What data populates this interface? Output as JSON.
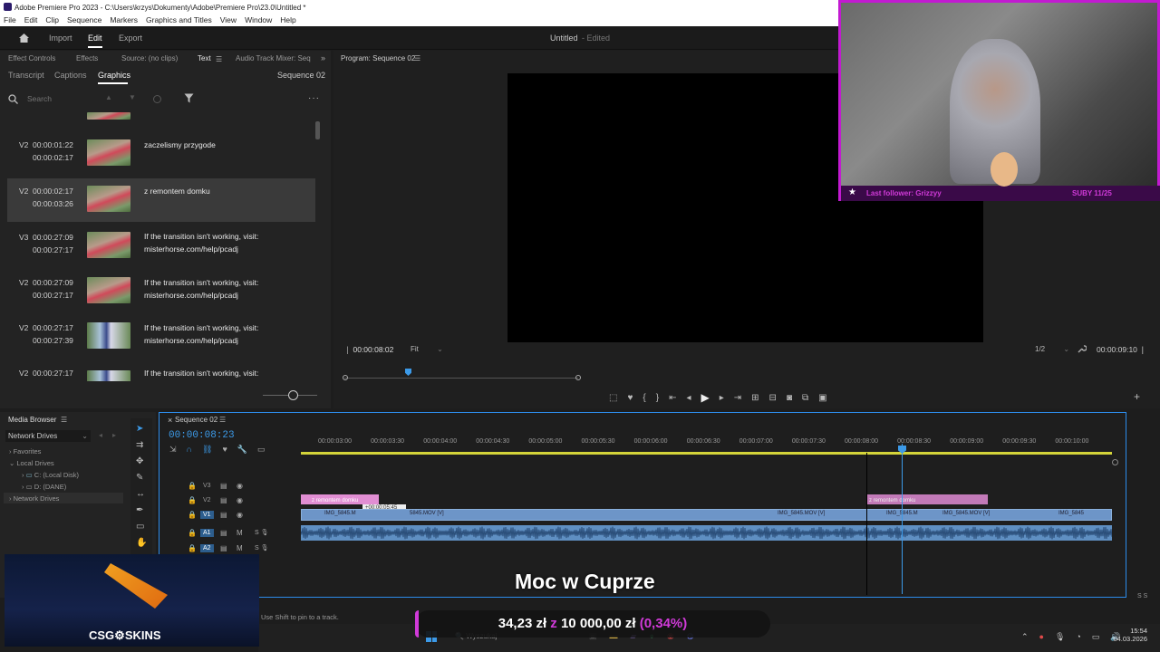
{
  "window": {
    "title": "Adobe Premiere Pro 2023 - C:\\Users\\krzys\\Dokumenty\\Adobe\\Premiere Pro\\23.0\\Untitled *"
  },
  "menu": [
    "File",
    "Edit",
    "Clip",
    "Sequence",
    "Markers",
    "Graphics and Titles",
    "View",
    "Window",
    "Help"
  ],
  "appbar": {
    "import": "Import",
    "edit": "Edit",
    "export": "Export",
    "project": "Untitled",
    "status": "- Edited"
  },
  "source_panel": {
    "tabs": [
      "Effect Controls",
      "Effects",
      "Source: (no clips)",
      "Text",
      "Audio Track Mixer: Seq"
    ],
    "subtabs": [
      "Transcript",
      "Captions",
      "Graphics"
    ],
    "sequence": "Sequence 02",
    "search_placeholder": "Search",
    "items": [
      {
        "track": "V2",
        "in": "00:00:01:22",
        "out": "00:00:02:17",
        "text1": "zaczelismy przygode",
        "text2": ""
      },
      {
        "track": "V2",
        "in": "00:00:02:17",
        "out": "00:00:03:26",
        "text1": "z remontem domku",
        "text2": ""
      },
      {
        "track": "V3",
        "in": "00:00:27:09",
        "out": "00:00:27:17",
        "text1": "If the transition isn't working, visit:",
        "text2": "misterhorse.com/help/pcadj"
      },
      {
        "track": "V2",
        "in": "00:00:27:09",
        "out": "00:00:27:17",
        "text1": "If the transition isn't working, visit:",
        "text2": "misterhorse.com/help/pcadj"
      },
      {
        "track": "V2",
        "in": "00:00:27:17",
        "out": "00:00:27:39",
        "text1": "If the transition isn't working, visit:",
        "text2": "misterhorse.com/help/pcadj"
      },
      {
        "track": "V2",
        "in": "00:00:27:17",
        "out": "",
        "text1": "If the transition isn't working, visit:",
        "text2": ""
      }
    ]
  },
  "program": {
    "title": "Program: Sequence 02",
    "timecode": "00:00:08:02",
    "fit": "Fit",
    "ratio": "1/2",
    "duration": "00:00:09:10"
  },
  "media_browser": {
    "title": "Media Browser",
    "location": "Network Drives",
    "tree": [
      "Favorites",
      "Local Drives",
      "C: (Local Disk)",
      "D: (DANE)",
      "Network Drives"
    ]
  },
  "timeline": {
    "title": "Sequence 02",
    "timecode": "00:00:08:23",
    "ruler": [
      "00:00:03:00",
      "00:00:03:30",
      "00:00:04:00",
      "00:00:04:30",
      "00:00:05:00",
      "00:00:05:30",
      "00:00:06:00",
      "00:00:06:30",
      "00:00:07:00",
      "00:00:07:30",
      "00:00:08:00",
      "00:00:08:30",
      "00:00:09:00",
      "00:00:09:30",
      "00:00:10:00"
    ],
    "tracks": [
      "V3",
      "V2",
      "V1",
      "A1",
      "A2"
    ],
    "clip_labels": {
      "g1": "z remontem domku",
      "g2": "z remontem domku",
      "tooltip": "+00:00:05:45",
      "v_a": "IMG_5845.M",
      "v_b": "5845.MOV [V]",
      "v_c": "IMG_5845.MOV [V]",
      "v_d": "IMG_5845.M",
      "v_e": "IMG_5845.MOV [V]",
      "v_f": "IMG_5845"
    }
  },
  "status_hint": "Use Shift to pin to a track.",
  "overlays": {
    "subtitle": "Moc w Cuprze",
    "money": "34,23 zł",
    "money_sep": "z",
    "money_goal": "10 000,00 zł",
    "money_pct": "(0,34%)",
    "sponsor": "CSG⚙SKINS",
    "last_follower": "Last follower: Grizzyy",
    "subs": "SUBY 11/25"
  },
  "taskbar": {
    "search": "Wyszukaj",
    "time": "15:54",
    "date": "04.03.2026"
  },
  "colors": {
    "accent": "#2d8ceb",
    "graphic_clip": "#e18ed3",
    "video_clip": "#6d95c8",
    "webcam_border": "#c21ad1"
  }
}
